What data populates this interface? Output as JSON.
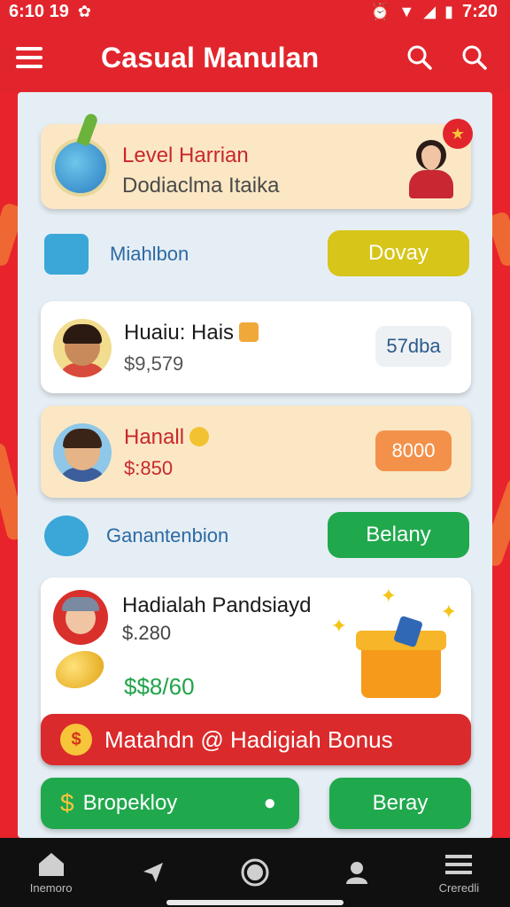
{
  "status_bar": {
    "time_left": "6:10 19",
    "time_right": "7:20"
  },
  "app_bar": {
    "title": "Casual Manulan"
  },
  "level_card": {
    "title": "Level Harrian",
    "subtitle": "Dodiaclma Itaika"
  },
  "section1": {
    "label": "Miahlbon",
    "button": "Dovay"
  },
  "players": [
    {
      "name": "Huaiu: Hais",
      "amount": "$9,579",
      "score": "57dba"
    },
    {
      "name": "Hanall",
      "amount": "$:850",
      "score": "8000"
    }
  ],
  "section2": {
    "label": "Ganantenbion",
    "button": "Belany"
  },
  "bonus_card": {
    "title": "Hadialah Pandsiayd",
    "line": "$.280",
    "total": "$$8/60"
  },
  "banner": {
    "text": "Matahdn @ Hadigiah Bonus"
  },
  "bottom": {
    "left_button": "Bropekloy",
    "right_button": "Beray"
  },
  "nav": {
    "left_label": "Inemoro",
    "right_label": "Creredli"
  },
  "colors": {
    "primary_red": "#e2252c",
    "green": "#20a84d",
    "yellow": "#d9c91c",
    "orange": "#f3914a"
  }
}
